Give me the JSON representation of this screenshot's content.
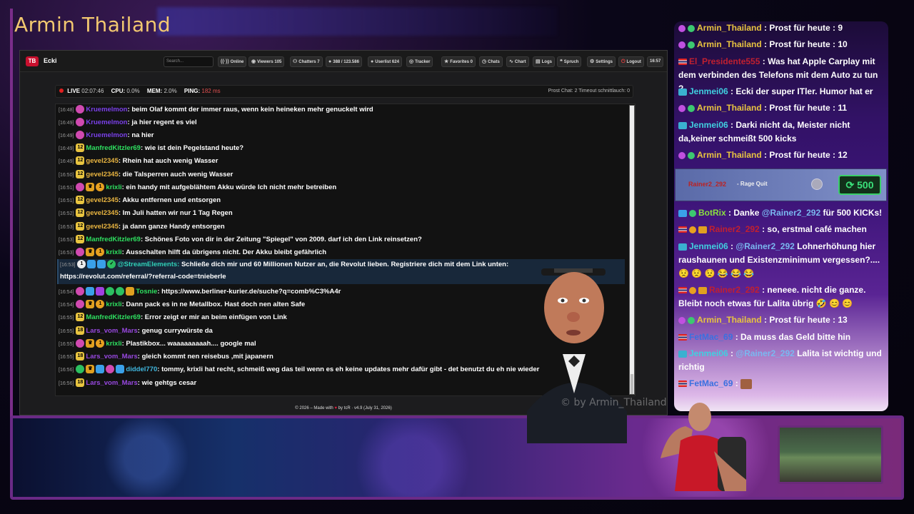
{
  "stream": {
    "title": "Armin Thailand",
    "watermark": "© by Armin_Thailand"
  },
  "navbar": {
    "logo": "TB",
    "brand": "Ecki",
    "search_placeholder": "Search...",
    "online": "Online",
    "viewers": "Viewers",
    "viewers_count": "105",
    "chatters": "Chatters",
    "chatters_count": "7",
    "messages": "388 / 123.586",
    "userlist": "Userlist",
    "userlist_count": "624",
    "tracker": "Tracker",
    "favorites": "Favorites",
    "favorites_count": "0",
    "chats": "Chats",
    "chart": "Chart",
    "logs": "Logs",
    "spruch": "Spruch",
    "settings": "Settings",
    "logout": "Logout",
    "time": "16:57"
  },
  "status": {
    "live_label": "LIVE",
    "live_time": "02:07:46",
    "cpu_label": "CPU:",
    "cpu_value": "0.0%",
    "mem_label": "MEM:",
    "mem_value": "2.0%",
    "ping_label": "PING:",
    "ping_value": "182 ms",
    "right": "Prost Chat: 2   Timeout schnittlauch: 0"
  },
  "chat": [
    {
      "time": "[16:48]",
      "user": "Kruemelmon",
      "text": "beim Olaf kommt der immer raus, wenn kein heineken mehr genuckelt wird"
    },
    {
      "time": "[16:49]",
      "user": "Kruemelmon",
      "text": "ja hier regent es viel"
    },
    {
      "time": "[16:49]",
      "user": "Kruemelmon",
      "text": "na hier"
    },
    {
      "time": "[16:49]",
      "user": "ManfredKitzler69",
      "text": "wie ist dein Pegelstand heute?"
    },
    {
      "time": "[16:49]",
      "user": "gevel2345",
      "text": "Rhein hat auch wenig Wasser"
    },
    {
      "time": "[16:50]",
      "user": "gevel2345",
      "text": "die Talsperren auch wenig Wasser"
    },
    {
      "time": "[16:51]",
      "user": "krixli",
      "text": "ein handy mit aufgeblähtem Akku würde Ich nicht mehr betreiben"
    },
    {
      "time": "[16:51]",
      "user": "gevel2345",
      "text": "Akku entfernen und entsorgen"
    },
    {
      "time": "[16:52]",
      "user": "gevel2345",
      "text": "Im Juli hatten wir nur 1 Tag Regen"
    },
    {
      "time": "[16:53]",
      "user": "gevel2345",
      "text": "ja dann ganze Handy entsorgen"
    },
    {
      "time": "[16:53]",
      "user": "ManfredKitzler69",
      "text": "Schönes Foto von dir in der Zeitung \"Spiegel\" von 2009. darf ich den Link reinsetzen?"
    },
    {
      "time": "[16:53]",
      "user": "krixli",
      "text": "Ausschalten hilft da übrigens nicht. Der Akku bleibt gefährlich"
    },
    {
      "time": "[16:54]",
      "user": "Tosnie",
      "text": "https://www.berliner-kurier.de/suche?q=comb%C3%A4r"
    },
    {
      "time": "[16:54]",
      "user": "krixli",
      "text": "Dann pack es in ne Metallbox. Hast doch nen alten Safe"
    },
    {
      "time": "[16:55]",
      "user": "ManfredKitzler69",
      "text": "Error zeigt er mir an beim einfügen von Link"
    },
    {
      "time": "[16:55]",
      "user": "Lars_vom_Mars",
      "text": "genug currywürste da"
    },
    {
      "time": "[16:55]",
      "user": "krixli",
      "text": "Plastikbox... waaaaaaaaah.... google mal"
    },
    {
      "time": "[16:55]",
      "user": "Lars_vom_Mars",
      "text": "gleich kommt nen reisebus ,mit japanern"
    },
    {
      "time": "[16:56]",
      "user": "diddel770",
      "text": "tommy, krixli hat recht, schmeiß weg das teil wenn es eh keine updates mehr dafür gibt - det benutzt du eh nie wieder"
    },
    {
      "time": "[16:56]",
      "user": "Lars_vom_Mars",
      "text": "wie gehtgs cesar"
    }
  ],
  "highlight": {
    "time": "[16:53]",
    "user": "@StreamElements:",
    "text1": "Schließe dich mir und 60 Millionen Nutzer an, die Revolut lieben. Registriere dich mit dem Link unten:",
    "text2": "https://revolut.com/referral/?referral-code=tnieberle"
  },
  "badges": {
    "b12": "12",
    "b18": "18",
    "b1": "1"
  },
  "footer": {
    "prefix": "© 2026 – Made with",
    "suffix": "by tcR · v4.9 (July 31, 2026)"
  },
  "right_chat": [
    {
      "user": "Armin_Thailand",
      "text": ": Prost für heute : 9"
    },
    {
      "user": "Armin_Thailand",
      "text": ": Prost für heute : 10"
    },
    {
      "user": "El_Presidente555",
      "text": ": Was hat Apple Carplay mit dem verbinden des Telefons mit dem Auto zu tun ?"
    },
    {
      "user": "Jenmei06",
      "text": ": Ecki der super ITler. Humor hat er"
    },
    {
      "user": "Armin_Thailand",
      "text": ": Prost für heute : 11"
    },
    {
      "user": "Jenmei06",
      "text": ": Darki nicht da, Meister nicht da,keiner schmeißt 500 kicks"
    },
    {
      "user": "Armin_Thailand",
      "text": ": Prost für heute : 12"
    },
    {
      "user": "BotRix",
      "text_pre": ": Danke",
      "mention": "@Rainer2_292",
      "text": "für 500 KICKs!"
    },
    {
      "user": "Rainer2_292",
      "text": ": so, erstmal café machen"
    },
    {
      "user": "Jenmei06",
      "text_pre": ":",
      "mention": "@Rainer2_292",
      "text": "Lohnerhöhung hier raushaunen und Existenzminimum vergessen?...."
    },
    {
      "user": "Rainer2_292",
      "text": ": neneee. nicht die ganze. Bleibt noch etwas für Lalita übrig"
    },
    {
      "user": "Armin_Thailand",
      "text": ": Prost für heute : 13"
    },
    {
      "user": "FetMac_69",
      "text": ": Da muss das Geld bitte hin"
    },
    {
      "user": "Jenmei06",
      "text_pre": ":",
      "mention": "@Rainer2_292",
      "text": "Lalita ist wichtig und richtig"
    },
    {
      "user": "FetMac_69",
      "text": ":"
    }
  ],
  "kick_alert": {
    "user": "Rainer2_292",
    "label": "- Rage Quit",
    "amount": "500"
  },
  "colors": {
    "accent": "#7a2d8a",
    "kick_green": "#3ad06a",
    "live_red": "#e02020"
  }
}
